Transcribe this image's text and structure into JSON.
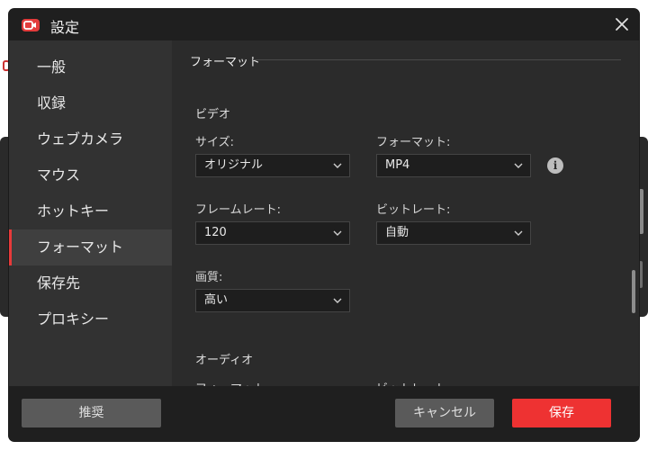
{
  "window": {
    "title": "設定"
  },
  "sidebar": {
    "items": [
      {
        "label": "一般"
      },
      {
        "label": "収録"
      },
      {
        "label": "ウェブカメラ"
      },
      {
        "label": "マウス"
      },
      {
        "label": "ホットキー"
      },
      {
        "label": "フォーマット",
        "active": true
      },
      {
        "label": "保存先"
      },
      {
        "label": "プロキシー"
      }
    ]
  },
  "content": {
    "section_title": "フォーマット",
    "video": {
      "title": "ビデオ",
      "size": {
        "label": "サイズ:",
        "value": "オリジナル"
      },
      "format": {
        "label": "フォーマット:",
        "value": "MP4"
      },
      "frame_rate": {
        "label": "フレームレート:",
        "value": "120"
      },
      "bit_rate": {
        "label": "ビットレート:",
        "value": "自動"
      },
      "quality": {
        "label": "画質:",
        "value": "高い"
      }
    },
    "audio": {
      "title": "オーディオ",
      "format": {
        "label": "フォーマット:"
      },
      "bit_rate": {
        "label": "ビットレート :"
      }
    }
  },
  "footer": {
    "recommend_label": "推奨",
    "cancel_label": "キャンセル",
    "save_label": "保存"
  },
  "colors": {
    "accent": "#ee3232",
    "dialog_bg": "#2b2b2b",
    "sidebar_bg": "#323232",
    "titlebar_bg": "#1f1f1f"
  },
  "icons": {
    "app": "video-camera-icon",
    "close": "close-icon",
    "info": "info-icon",
    "dropdown": "chevron-down-icon"
  }
}
